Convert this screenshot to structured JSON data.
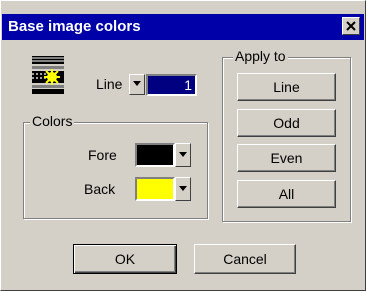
{
  "window": {
    "title": "Base image colors",
    "close_glyph": "×"
  },
  "line": {
    "label": "Line",
    "value": "1"
  },
  "colors": {
    "group_label": "Colors",
    "fore_label": "Fore",
    "fore_color": "#000000",
    "back_label": "Back",
    "back_color": "#ffff00"
  },
  "apply_to": {
    "group_label": "Apply to",
    "buttons": [
      "Line",
      "Odd",
      "Even",
      "All"
    ]
  },
  "actions": {
    "ok": "OK",
    "cancel": "Cancel"
  },
  "theme": {
    "titlebar": "#0000a8",
    "face": "#d4d0c8",
    "selection": "#000080"
  },
  "icons": {
    "preview": "image-preview-icon",
    "dropdown": "chevron-down-icon",
    "close": "close-icon"
  }
}
